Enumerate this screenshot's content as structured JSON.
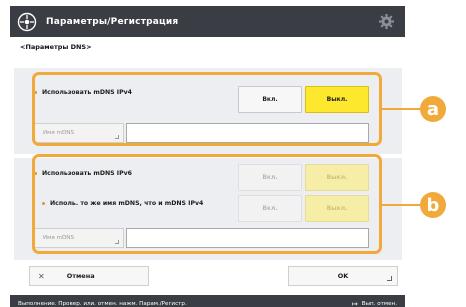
{
  "colors": {
    "accent": "#f0a93a",
    "selected": "#fde82e",
    "titlebar": "#3a3d43"
  },
  "header": {
    "title": "Параметры/Регистрация",
    "icon": "settings-wheel-icon",
    "right_icon": "gear-icon"
  },
  "breadcrumb": "<Параметры DNS>",
  "section_a": {
    "label": "Использовать mDNS IPv4",
    "off_label": "Вкл.",
    "on_label": "Выкл.",
    "selected": "Выкл.",
    "name_button": "Имя mDNS",
    "name_value": ""
  },
  "section_b": {
    "label": "Использовать mDNS IPv6",
    "sub_label": "Исполь. то же имя mDNS, что и mDNS IPv4",
    "off_label": "Вкл.",
    "on_label": "Выкл.",
    "sub_off_label": "Вкл.",
    "sub_on_label": "Выкл.",
    "name_button": "Имя mDNS",
    "name_value": ""
  },
  "footer": {
    "cancel_label": "Отмена",
    "ok_label": "OK"
  },
  "statusbar": {
    "message": "Выполнение. Провер. или. отмен. нажм. Парам./Регистр.",
    "right_label": "Вып. отмен."
  },
  "callouts": {
    "a": "a",
    "b": "b"
  }
}
